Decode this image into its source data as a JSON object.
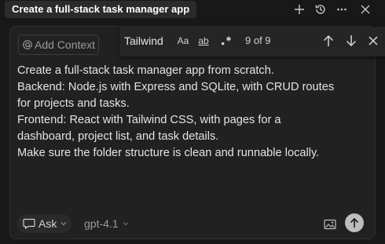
{
  "window": {
    "title": "Create a full-stack task manager app"
  },
  "context": {
    "add_label": "Add Context"
  },
  "find": {
    "value": "Tailwind",
    "match_case_label": "Aa",
    "whole_word_label": "ab",
    "count": "9 of 9"
  },
  "prompt": {
    "lines": [
      "Create a full-stack task manager app from scratch.",
      "Backend: Node.js with Express and SQLite, with CRUD routes",
      "for projects and tasks.",
      "Frontend: React with Tailwind CSS, with pages for a",
      "dashboard, project list, and task details.",
      "Make sure the folder structure is clean and runnable locally."
    ]
  },
  "composer": {
    "mode_label": "Ask",
    "model_label": "gpt-4.1"
  },
  "icons": {
    "new_chat": "plus-icon",
    "history": "history-icon",
    "more": "ellipsis-icon",
    "close": "close-icon",
    "regex": "regex-icon",
    "previous": "arrow-up-icon",
    "next": "arrow-down-icon",
    "close_find": "close-find-icon",
    "image": "image-icon",
    "send": "send-arrow-icon"
  },
  "colors": {
    "background": "#181818",
    "panel": "#212121",
    "findbar": "#252526",
    "send_button": "#bdbdbd"
  }
}
